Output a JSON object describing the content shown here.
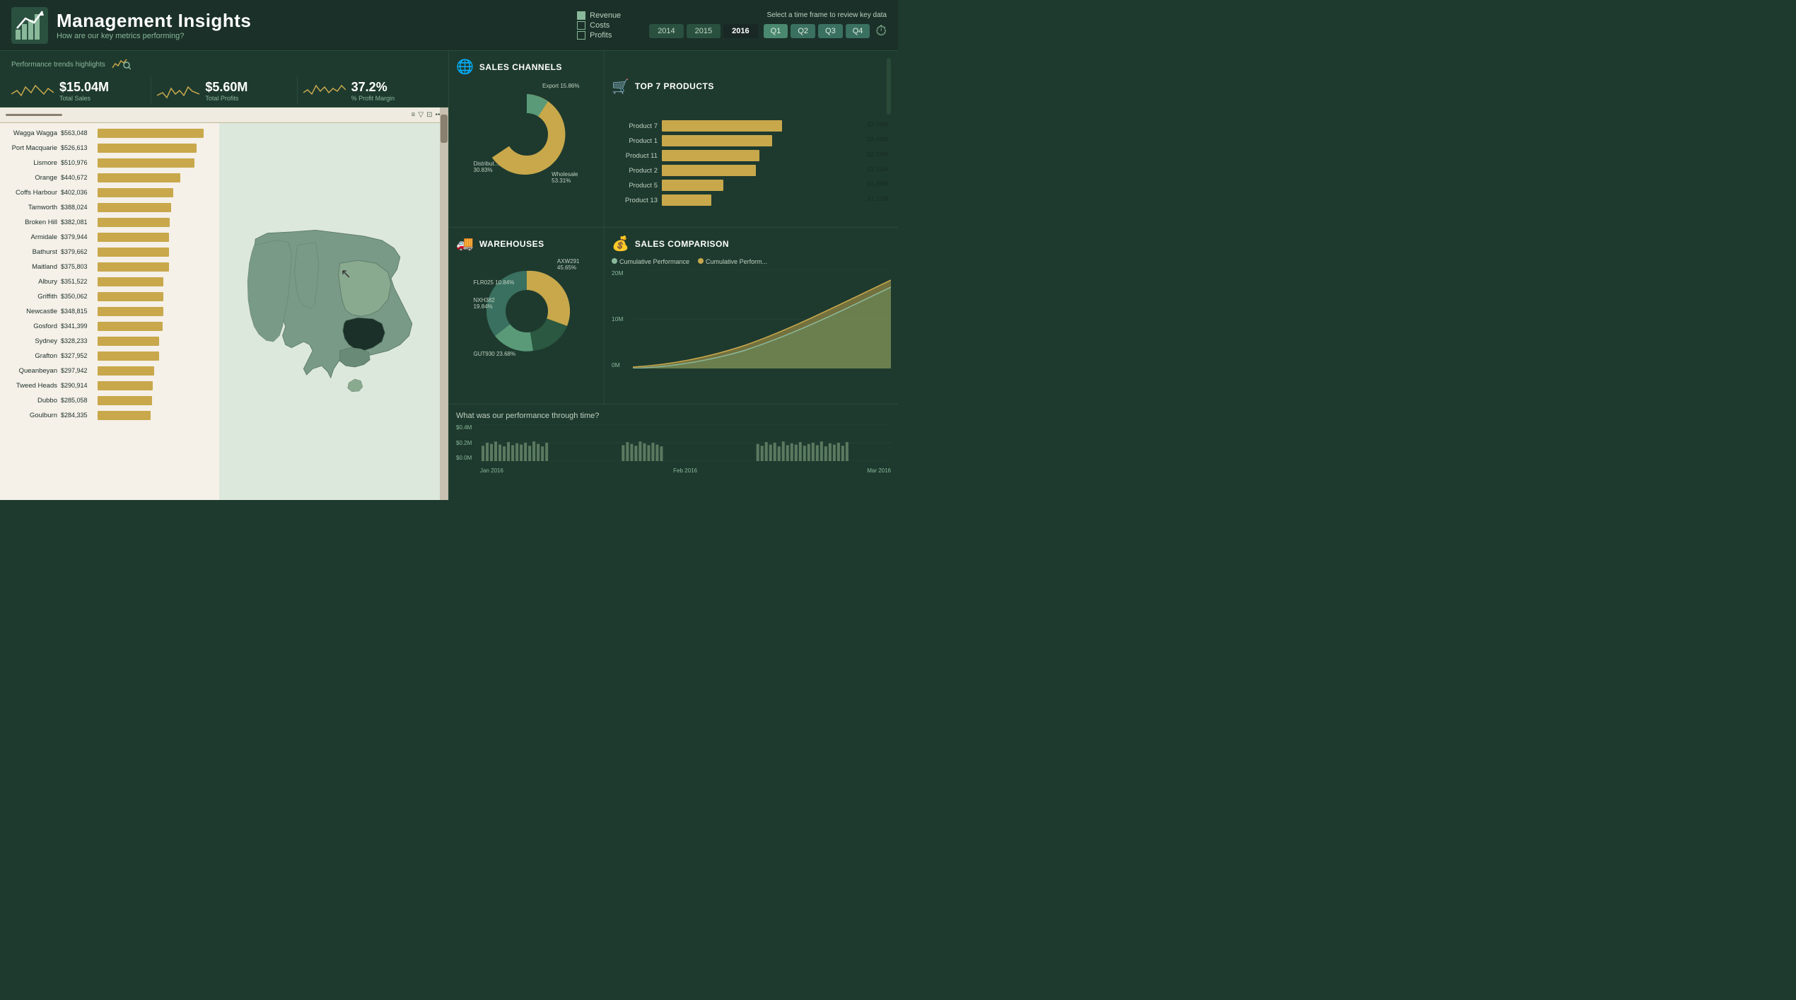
{
  "header": {
    "title": "Management Insights",
    "subtitle": "How are our key metrics performing?",
    "legend": {
      "items": [
        "Revenue",
        "Costs",
        "Profits"
      ]
    },
    "time_label": "Select a time frame to review key data",
    "years": [
      "2014",
      "2015",
      "2016"
    ],
    "active_year": "2016",
    "quarters": [
      "Q1",
      "Q2",
      "Q3",
      "Q4"
    ],
    "active_quarter": "Q1"
  },
  "kpi": {
    "label": "Performance trends highlights",
    "total_sales": "$15.04M",
    "total_sales_sub": "Total Sales",
    "total_profits": "$5.60M",
    "total_profits_sub": "Total Profits",
    "profit_margin": "37.2%",
    "profit_margin_sub": "% Profit Margin"
  },
  "bar_chart": {
    "cities": [
      {
        "name": "Wagga Wagga",
        "value": "$563,048",
        "pct": 100
      },
      {
        "name": "Port Macquarie",
        "value": "$526,613",
        "pct": 93
      },
      {
        "name": "Lismore",
        "value": "$510,976",
        "pct": 91
      },
      {
        "name": "Orange",
        "value": "$440,672",
        "pct": 78
      },
      {
        "name": "Coffs Harbour",
        "value": "$402,036",
        "pct": 71
      },
      {
        "name": "Tamworth",
        "value": "$388,024",
        "pct": 69
      },
      {
        "name": "Broken Hill",
        "value": "$382,081",
        "pct": 68
      },
      {
        "name": "Armidale",
        "value": "$379,944",
        "pct": 67
      },
      {
        "name": "Bathurst",
        "value": "$379,662",
        "pct": 67
      },
      {
        "name": "Maitland",
        "value": "$375,803",
        "pct": 67
      },
      {
        "name": "Albury",
        "value": "$351,522",
        "pct": 62
      },
      {
        "name": "Griffith",
        "value": "$350,062",
        "pct": 62
      },
      {
        "name": "Newcastle",
        "value": "$348,815",
        "pct": 62
      },
      {
        "name": "Gosford",
        "value": "$341,399",
        "pct": 61
      },
      {
        "name": "Sydney",
        "value": "$328,233",
        "pct": 58
      },
      {
        "name": "Grafton",
        "value": "$327,952",
        "pct": 58
      },
      {
        "name": "Queanbeyan",
        "value": "$297,942",
        "pct": 53
      },
      {
        "name": "Tweed Heads",
        "value": "$290,914",
        "pct": 52
      },
      {
        "name": "Dubbo",
        "value": "$285,058",
        "pct": 51
      },
      {
        "name": "Goulburn",
        "value": "$284,335",
        "pct": 50
      }
    ]
  },
  "sales_channels": {
    "title": "SALES CHANNELS",
    "segments": [
      {
        "name": "Wholesale",
        "pct": 53.31,
        "color": "#c8a84b"
      },
      {
        "name": "Distribut...",
        "pct": 30.83,
        "color": "#3a7060"
      },
      {
        "name": "Export",
        "pct": 15.86,
        "color": "#5a9a78"
      }
    ]
  },
  "top_products": {
    "title": "TOP 7 PRODUCTS",
    "products": [
      {
        "name": "Product 7",
        "value": "$2.70M",
        "pct": 100
      },
      {
        "name": "Product 1",
        "value": "$2.49M",
        "pct": 92
      },
      {
        "name": "Product 11",
        "value": "$2.19M",
        "pct": 81
      },
      {
        "name": "Product 2",
        "value": "$2.11M",
        "pct": 78
      },
      {
        "name": "Product 5",
        "value": "$1.39M",
        "pct": 51
      },
      {
        "name": "Product 13",
        "value": "$1.11M",
        "pct": 41
      }
    ]
  },
  "warehouses": {
    "title": "WAREHOUSES",
    "segments": [
      {
        "name": "AXW291",
        "pct": 45.65,
        "color": "#c8a84b"
      },
      {
        "name": "NXH382",
        "pct": 19.84,
        "color": "#3a7060"
      },
      {
        "name": "GUT930",
        "pct": 23.68,
        "color": "#5a9a78"
      },
      {
        "name": "FLR025",
        "pct": 10.84,
        "color": "#2a5840"
      }
    ]
  },
  "sales_comparison": {
    "title": "SALES COMPARISON",
    "legend": [
      "Cumulative Performance",
      "Cumulative Perform..."
    ],
    "y_labels": [
      "20M",
      "10M",
      "0M"
    ]
  },
  "performance": {
    "title": "What was our performance through time?",
    "y_labels": [
      "$0.4M",
      "$0.2M",
      "$0.0M"
    ],
    "x_labels": [
      "Jan 2016",
      "Feb 2016",
      "Mar 2016"
    ]
  }
}
